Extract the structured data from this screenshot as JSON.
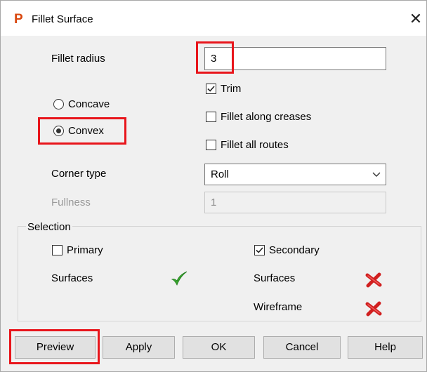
{
  "title_bar": {
    "app_icon_glyph": "P",
    "title": "Fillet Surface",
    "close_glyph": "✕"
  },
  "form": {
    "fillet_radius_label": "Fillet radius",
    "fillet_radius_value": "3",
    "trim_label": "Trim",
    "trim_checked": true,
    "concave_label": "Concave",
    "convex_label": "Convex",
    "selected_radio": "Convex",
    "fillet_along_creases_label": "Fillet along creases",
    "fillet_along_creases_checked": false,
    "fillet_all_routes_label": "Fillet all routes",
    "fillet_all_routes_checked": false,
    "corner_type_label": "Corner type",
    "corner_type_value": "Roll",
    "fullness_label": "Fullness",
    "fullness_value": "1"
  },
  "selection": {
    "group_label": "Selection",
    "primary_label": "Primary",
    "primary_checked": false,
    "secondary_label": "Secondary",
    "secondary_checked": true,
    "primary_surfaces_label": "Surfaces",
    "primary_surfaces_status": "ok",
    "secondary_surfaces_label": "Surfaces",
    "secondary_surfaces_status": "none",
    "secondary_wireframe_label": "Wireframe",
    "secondary_wireframe_status": "none"
  },
  "buttons": {
    "preview": "Preview",
    "apply": "Apply",
    "ok": "OK",
    "cancel": "Cancel",
    "help": "Help"
  },
  "highlight_color": "#e8151b",
  "icons": [
    "app-icon",
    "close-icon",
    "checkmark-icon",
    "chevron-down-icon",
    "green-check-icon",
    "red-cross-icon"
  ]
}
